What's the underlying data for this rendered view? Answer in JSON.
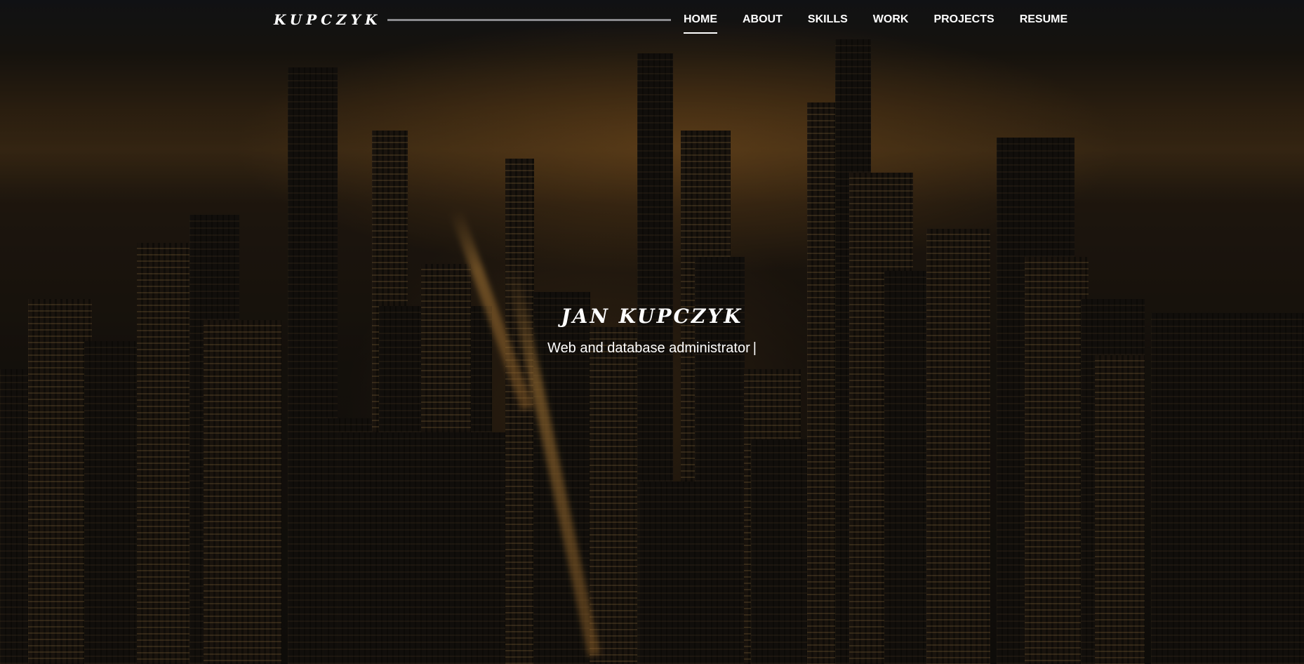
{
  "header": {
    "logo": "KUPCZYK",
    "nav": [
      {
        "label": "HOME",
        "active": true
      },
      {
        "label": "ABOUT",
        "active": false
      },
      {
        "label": "SKILLS",
        "active": false
      },
      {
        "label": "WORK",
        "active": false
      },
      {
        "label": "PROJECTS",
        "active": false
      },
      {
        "label": "RESUME",
        "active": false
      }
    ]
  },
  "hero": {
    "name": "JAN KUPCZYK",
    "subtitle": "Web and database administrator",
    "cursor": "|"
  },
  "colors": {
    "text": "#ffffff",
    "logo_line": "#8a8a8e",
    "city_glow": "#b07028"
  }
}
